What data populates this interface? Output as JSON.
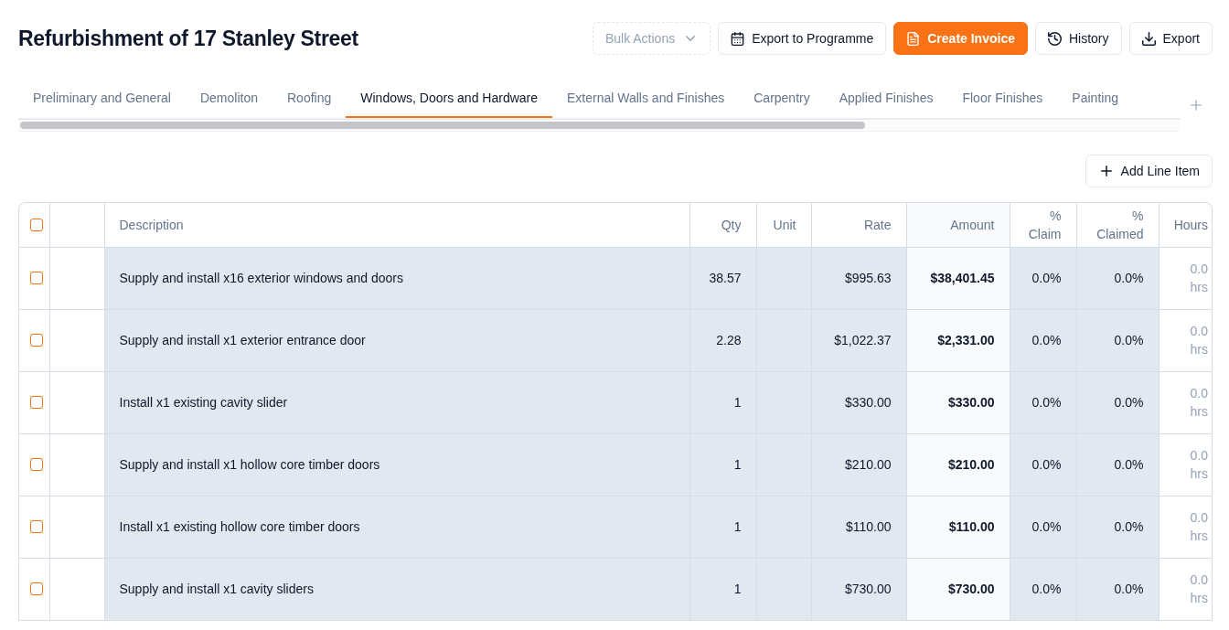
{
  "page": {
    "title": "Refurbishment of 17 Stanley Street"
  },
  "actions": [
    {
      "kind": "dropdown",
      "label": "Bulk Actions",
      "disabled": true
    },
    {
      "kind": "outline",
      "label": "Export to Programme",
      "disabled": false
    },
    {
      "kind": "primary",
      "label": "Create Invoice",
      "disabled": false
    },
    {
      "kind": "outline",
      "label": "History",
      "disabled": false
    },
    {
      "kind": "outline",
      "label": "Export",
      "disabled": false
    }
  ],
  "tabs": [
    {
      "label": "Preliminary and General",
      "selected": false
    },
    {
      "label": "Demoliton",
      "selected": false
    },
    {
      "label": "Roofing",
      "selected": false
    },
    {
      "label": "Windows, Doors and Hardware",
      "selected": true
    },
    {
      "label": "External Walls and Finishes",
      "selected": false
    },
    {
      "label": "Carpentry",
      "selected": false
    },
    {
      "label": "Applied Finishes",
      "selected": false
    },
    {
      "label": "Floor Finishes",
      "selected": false
    },
    {
      "label": "Painting",
      "selected": false
    }
  ],
  "toolbar": {
    "add_button": "Add Line Item"
  },
  "table": {
    "columns": [
      {
        "kind": "select",
        "checked": false
      },
      {
        "kind": "spacer"
      },
      {
        "kind": "text",
        "label": "Description"
      },
      {
        "kind": "number",
        "label": "Qty"
      },
      {
        "kind": "number",
        "label": "Unit"
      },
      {
        "kind": "number",
        "label": "Rate"
      },
      {
        "kind": "total",
        "label": "Amount"
      },
      {
        "kind": "number",
        "label": "% Claim"
      },
      {
        "kind": "number",
        "label": "% Claimed"
      },
      {
        "kind": "hours",
        "label": "Hours"
      }
    ],
    "rows": [
      {
        "checked": false,
        "description": "Supply and install x16 exterior windows and doors",
        "qty": "38.57",
        "rate": "$995.63",
        "amount": "$38,401.45",
        "claim": "0.0%",
        "claimed": "0.0%",
        "hours": "0.0 hrs"
      },
      {
        "checked": false,
        "description": "Supply and install x1 exterior entrance door",
        "qty": "2.28",
        "rate": "$1,022.37",
        "amount": "$2,331.00",
        "claim": "0.0%",
        "claimed": "0.0%",
        "hours": "0.0 hrs"
      },
      {
        "checked": false,
        "description": "Install x1 existing cavity slider",
        "qty": "1",
        "rate": "$330.00",
        "amount": "$330.00",
        "claim": "0.0%",
        "claimed": "0.0%",
        "hours": "0.0 hrs"
      },
      {
        "checked": false,
        "description": "Supply and install x1 hollow core timber doors",
        "qty": "1",
        "rate": "$210.00",
        "amount": "$210.00",
        "claim": "0.0%",
        "claimed": "0.0%",
        "hours": "0.0 hrs"
      },
      {
        "checked": false,
        "description": "Install x1 existing hollow core timber doors",
        "qty": "1",
        "rate": "$110.00",
        "amount": "$110.00",
        "claim": "0.0%",
        "claimed": "0.0%",
        "hours": "0.0 hrs"
      },
      {
        "checked": false,
        "description": "Supply and install x1 cavity sliders",
        "qty": "1",
        "rate": "$730.00",
        "amount": "$730.00",
        "claim": "0.0%",
        "claimed": "0.0%",
        "hours": "0.0 hrs"
      }
    ]
  }
}
